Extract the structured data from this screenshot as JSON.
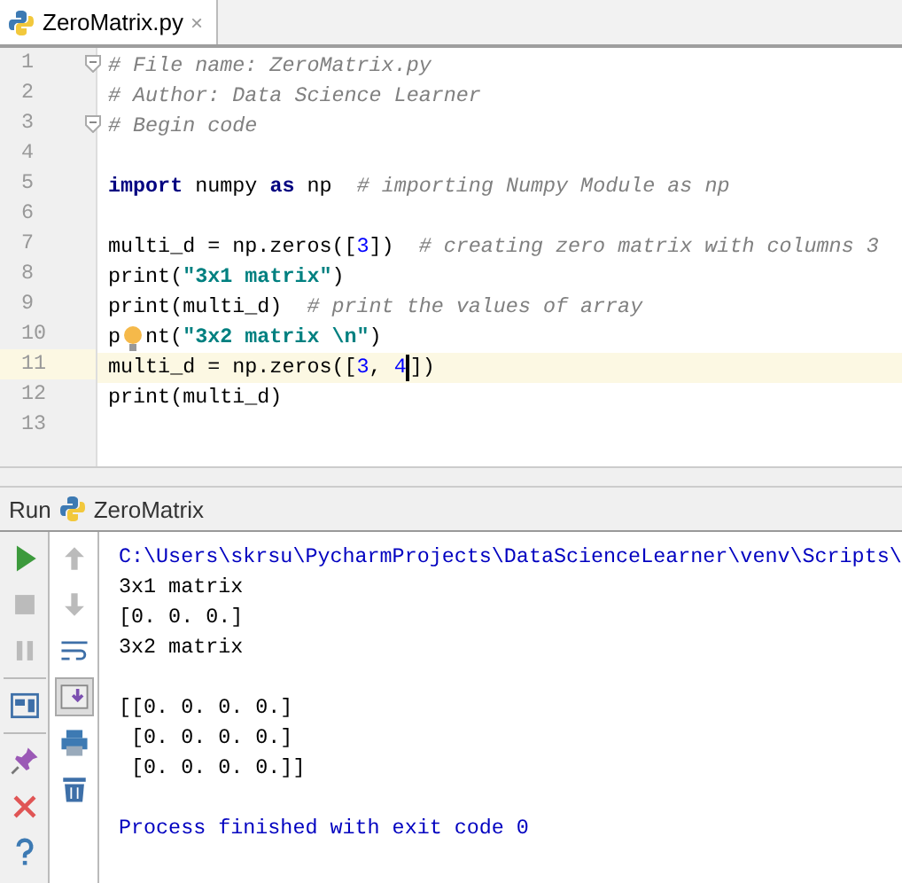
{
  "editor_tabs": [
    {
      "label": "ZeroMatrix.py",
      "selected": true,
      "close_label": "×"
    }
  ],
  "editor": {
    "lines": [
      {
        "number": "1",
        "current": false,
        "fold": true,
        "tokens": [
          {
            "kind": "comment",
            "text": "# File name: ZeroMatrix.py"
          }
        ]
      },
      {
        "number": "2",
        "current": false,
        "tokens": [
          {
            "kind": "comment",
            "text": "# Author: Data Science Learner"
          }
        ]
      },
      {
        "number": "3",
        "current": false,
        "fold": true,
        "tokens": [
          {
            "kind": "comment",
            "text": "# Begin code"
          }
        ]
      },
      {
        "number": "4",
        "current": false
      },
      {
        "number": "5",
        "current": false,
        "tokens": [
          {
            "kind": "keyword",
            "text": "import"
          },
          {
            "kind": "plain",
            "text": " numpy "
          },
          {
            "kind": "keyword",
            "text": "as"
          },
          {
            "kind": "plain",
            "text": " np  "
          },
          {
            "kind": "comment",
            "text": "# importing Numpy Module as np"
          }
        ]
      },
      {
        "number": "6",
        "current": false
      },
      {
        "number": "7",
        "current": false,
        "tokens": [
          {
            "kind": "plain",
            "text": "multi_d = np.zeros(["
          },
          {
            "kind": "number",
            "text": "3"
          },
          {
            "kind": "plain",
            "text": "])  "
          },
          {
            "kind": "comment",
            "text": "# creating zero matrix with columns 3"
          }
        ]
      },
      {
        "number": "8",
        "current": false,
        "tokens": [
          {
            "kind": "plain",
            "text": "print("
          },
          {
            "kind": "string",
            "text": "\"3x1 matrix\""
          },
          {
            "kind": "plain",
            "text": ")"
          }
        ]
      },
      {
        "number": "9",
        "current": false,
        "tokens": [
          {
            "kind": "plain",
            "text": "print(multi_d)  "
          },
          {
            "kind": "comment",
            "text": "# print the values of array"
          }
        ]
      },
      {
        "number": "10",
        "current": false,
        "tokens": [
          {
            "kind": "plain",
            "text": "p"
          },
          {
            "kind": "bulb"
          },
          {
            "kind": "plain",
            "text": "nt("
          },
          {
            "kind": "string",
            "text": "\"3x2 matrix \\n\""
          },
          {
            "kind": "plain",
            "text": ")"
          }
        ]
      },
      {
        "number": "11",
        "current": true,
        "tokens": [
          {
            "kind": "plain",
            "text": "multi_d = np.zeros(["
          },
          {
            "kind": "number",
            "text": "3"
          },
          {
            "kind": "plain",
            "text": ", "
          },
          {
            "kind": "number",
            "text": "4"
          },
          {
            "kind": "caret"
          },
          {
            "kind": "plain",
            "text": "])"
          }
        ]
      },
      {
        "number": "12",
        "current": false,
        "tokens": [
          {
            "kind": "plain",
            "text": "print(multi_d)"
          }
        ]
      },
      {
        "number": "13",
        "current": false
      }
    ]
  },
  "run_panel": {
    "label": "Run",
    "config": "ZeroMatrix",
    "main_toolbar": [
      {
        "kind": "run",
        "disabled": false
      },
      {
        "kind": "stop",
        "disabled": true
      },
      {
        "kind": "pause",
        "disabled": true
      },
      {
        "kind": "separator"
      },
      {
        "kind": "layout"
      },
      {
        "kind": "separator"
      },
      {
        "kind": "pin"
      },
      {
        "kind": "close"
      },
      {
        "kind": "help"
      }
    ],
    "side_toolbar": [
      {
        "kind": "up",
        "disabled": true,
        "selected": false
      },
      {
        "kind": "down",
        "disabled": true,
        "selected": false
      },
      {
        "kind": "wrap",
        "selected": false
      },
      {
        "kind": "scroll-end",
        "selected": true
      },
      {
        "kind": "print",
        "selected": false
      },
      {
        "kind": "trash",
        "selected": false
      }
    ],
    "console": [
      {
        "kind": "system",
        "text": "C:\\Users\\skrsu\\PycharmProjects\\DataScienceLearner\\venv\\Scripts\\"
      },
      {
        "kind": "output",
        "text": "3x1 matrix"
      },
      {
        "kind": "output",
        "text": "[0. 0. 0.]"
      },
      {
        "kind": "output",
        "text": "3x2 matrix"
      },
      {
        "kind": "blank"
      },
      {
        "kind": "output",
        "text": "[[0. 0. 0. 0.]"
      },
      {
        "kind": "output",
        "text": " [0. 0. 0. 0.]"
      },
      {
        "kind": "output",
        "text": " [0. 0. 0. 0.]]"
      },
      {
        "kind": "blank"
      },
      {
        "kind": "system",
        "text": "Process finished with exit code 0"
      }
    ]
  }
}
